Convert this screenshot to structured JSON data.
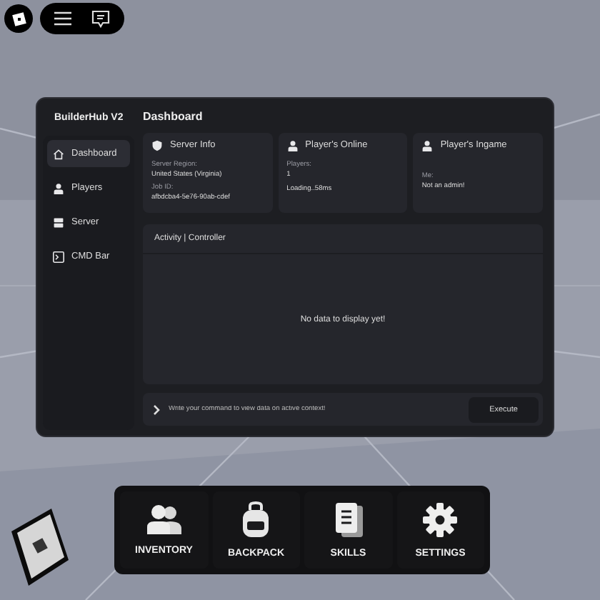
{
  "topbar": {
    "buttons": [
      {
        "kind": "menu"
      },
      {
        "kind": "chat"
      }
    ]
  },
  "panel": {
    "title": "BuilderHub V2",
    "heading": "Dashboard",
    "sidebar": {
      "items": [
        {
          "label": "Dashboard",
          "kind": "home",
          "selected": true
        },
        {
          "label": "Players",
          "kind": "person",
          "selected": false
        },
        {
          "label": "Server",
          "kind": "server",
          "selected": false
        },
        {
          "label": "CMD Bar",
          "kind": "terminal",
          "selected": false
        }
      ]
    },
    "cards": [
      {
        "title": "Server Info",
        "kind": "shield",
        "lines": [
          {
            "kind": "label",
            "text": "Server Region:"
          },
          {
            "kind": "value",
            "text": "United States (Virginia)"
          },
          {
            "kind": "label",
            "text": "Job ID:"
          },
          {
            "kind": "value",
            "text": "afbdcba4-5e76-90ab-cdef"
          }
        ]
      },
      {
        "title": "Player's Online",
        "kind": "person",
        "lines": [
          {
            "kind": "label",
            "text": "Players:"
          },
          {
            "kind": "value",
            "text": "1"
          },
          {
            "kind": "value",
            "text": "Loading..58ms"
          }
        ]
      },
      {
        "title": "Player's Ingame",
        "kind": "person",
        "lines": [
          {
            "kind": "spacer"
          },
          {
            "kind": "label",
            "text": "Me:"
          },
          {
            "kind": "value",
            "text": "Not an admin!"
          }
        ]
      }
    ],
    "activity": {
      "title": "Activity | Controller",
      "empty": "No data to display yet!"
    },
    "command": {
      "placeholder": "Write your command to view data on active context!",
      "button": "Execute"
    }
  },
  "hotbar": [
    {
      "label": "INVENTORY",
      "kind": "people"
    },
    {
      "label": "BACKPACK",
      "kind": "backpack"
    },
    {
      "label": "SKILLS",
      "kind": "notebook"
    },
    {
      "label": "SETTINGS",
      "kind": "gear"
    }
  ]
}
